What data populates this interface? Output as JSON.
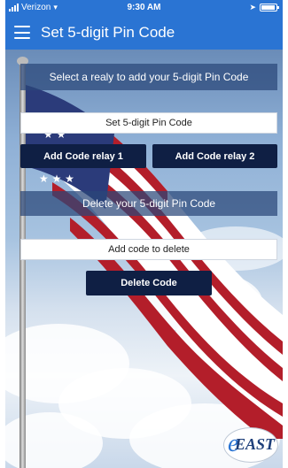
{
  "status_bar": {
    "carrier": "Verizon",
    "time": "9:30 AM"
  },
  "app_bar": {
    "title": "Set 5-digit Pin Code"
  },
  "main": {
    "select_relay_text": "Select a realy to add your 5-digit Pin Code",
    "set_pin_input_placeholder": "Set 5-digit Pin Code",
    "add_relay1_label": "Add Code relay 1",
    "add_relay2_label": "Add Code relay 2",
    "delete_section_text": "Delete your 5-digit Pin Code",
    "delete_input_placeholder": "Add code to delete",
    "delete_button_label": "Delete Code"
  },
  "logo": {
    "text": "EAST"
  },
  "colors": {
    "app_bar": "#2a74d3",
    "panel": "#2a4678",
    "button": "#0f1f44"
  }
}
